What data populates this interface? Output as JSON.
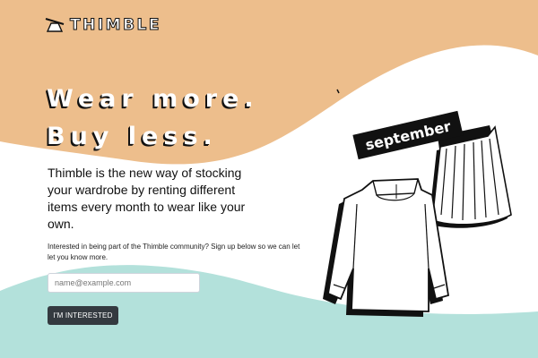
{
  "brand": {
    "name": "THIMBLE",
    "logo_icon": "thimble-logo-icon"
  },
  "hero": {
    "line1": "Wear more.",
    "line2": "Buy less."
  },
  "lead": "Thimble is the new way of stocking your wardrobe by renting different items every month to wear like your own.",
  "signup": {
    "prompt": "Interested in being part of the Thimble community? Sign up below so we can let let you know more.",
    "email_placeholder": "name@example.com",
    "button_label": "I'M INTERESTED"
  },
  "illustration": {
    "month_tag": "september",
    "items": [
      "sweater-illustration",
      "skirt-illustration"
    ]
  },
  "colors": {
    "tan": "#EDBE8C",
    "mint": "#B3E1DB",
    "button": "#343A40"
  }
}
